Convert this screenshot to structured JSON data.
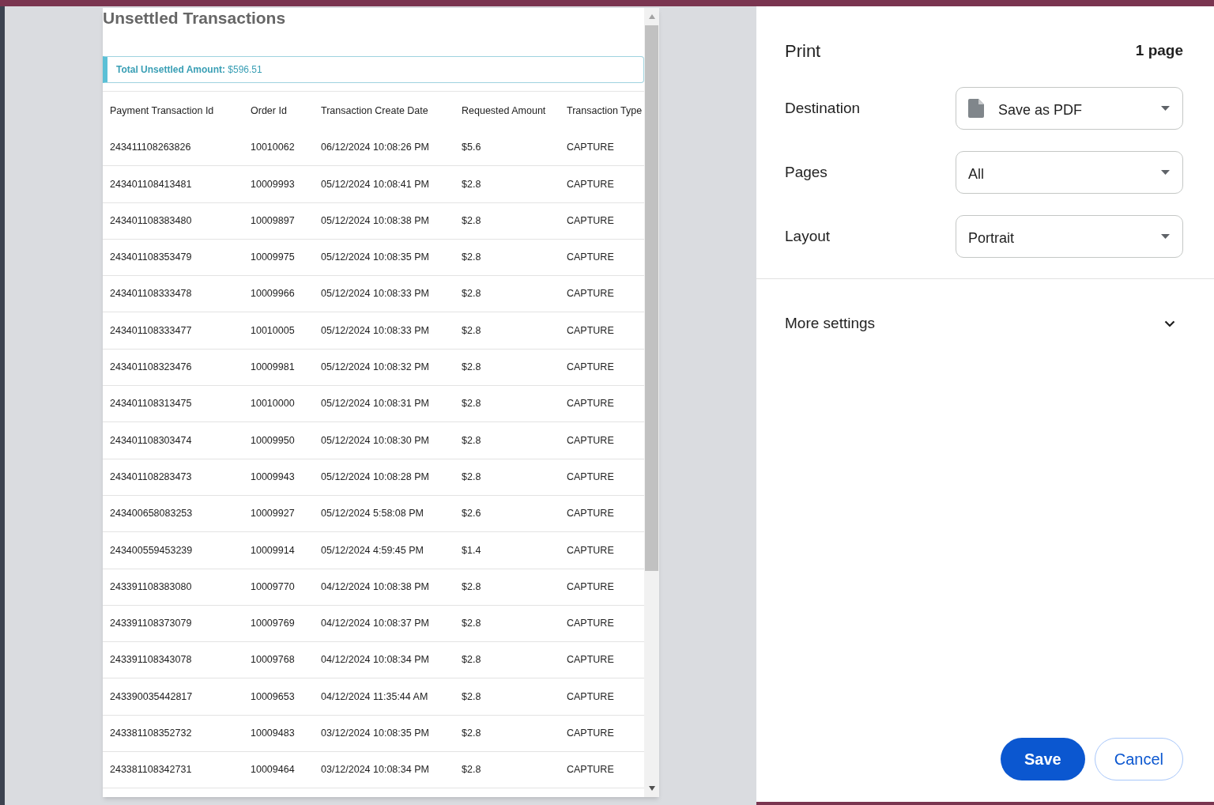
{
  "preview": {
    "title": "Unsettled Transactions",
    "total": {
      "label": "Total Unsettled Amount:",
      "value": "$596.51"
    },
    "columns": [
      "Payment Transaction Id",
      "Order Id",
      "Transaction Create Date",
      "Requested Amount",
      "Transaction Type"
    ],
    "rows": [
      [
        "243411108263826",
        "10010062",
        "06/12/2024 10:08:26 PM",
        "$5.6",
        "CAPTURE"
      ],
      [
        "243401108413481",
        "10009993",
        "05/12/2024 10:08:41 PM",
        "$2.8",
        "CAPTURE"
      ],
      [
        "243401108383480",
        "10009897",
        "05/12/2024 10:08:38 PM",
        "$2.8",
        "CAPTURE"
      ],
      [
        "243401108353479",
        "10009975",
        "05/12/2024 10:08:35 PM",
        "$2.8",
        "CAPTURE"
      ],
      [
        "243401108333478",
        "10009966",
        "05/12/2024 10:08:33 PM",
        "$2.8",
        "CAPTURE"
      ],
      [
        "243401108333477",
        "10010005",
        "05/12/2024 10:08:33 PM",
        "$2.8",
        "CAPTURE"
      ],
      [
        "243401108323476",
        "10009981",
        "05/12/2024 10:08:32 PM",
        "$2.8",
        "CAPTURE"
      ],
      [
        "243401108313475",
        "10010000",
        "05/12/2024 10:08:31 PM",
        "$2.8",
        "CAPTURE"
      ],
      [
        "243401108303474",
        "10009950",
        "05/12/2024 10:08:30 PM",
        "$2.8",
        "CAPTURE"
      ],
      [
        "243401108283473",
        "10009943",
        "05/12/2024 10:08:28 PM",
        "$2.8",
        "CAPTURE"
      ],
      [
        "243400658083253",
        "10009927",
        "05/12/2024 5:58:08 PM",
        "$2.6",
        "CAPTURE"
      ],
      [
        "243400559453239",
        "10009914",
        "05/12/2024 4:59:45 PM",
        "$1.4",
        "CAPTURE"
      ],
      [
        "243391108383080",
        "10009770",
        "04/12/2024 10:08:38 PM",
        "$2.8",
        "CAPTURE"
      ],
      [
        "243391108373079",
        "10009769",
        "04/12/2024 10:08:37 PM",
        "$2.8",
        "CAPTURE"
      ],
      [
        "243391108343078",
        "10009768",
        "04/12/2024 10:08:34 PM",
        "$2.8",
        "CAPTURE"
      ],
      [
        "243390035442817",
        "10009653",
        "04/12/2024 11:35:44 AM",
        "$2.8",
        "CAPTURE"
      ],
      [
        "243381108352732",
        "10009483",
        "03/12/2024 10:08:35 PM",
        "$2.8",
        "CAPTURE"
      ],
      [
        "243381108342731",
        "10009464",
        "03/12/2024 10:08:34 PM",
        "$2.8",
        "CAPTURE"
      ]
    ]
  },
  "print_panel": {
    "title": "Print",
    "page_count": "1 page",
    "settings": [
      {
        "label": "Destination",
        "value": "Save as PDF",
        "icon": true
      },
      {
        "label": "Pages",
        "value": "All",
        "icon": false
      },
      {
        "label": "Layout",
        "value": "Portrait",
        "icon": false
      }
    ],
    "more_settings": "More settings",
    "buttons": [
      {
        "label": "Save",
        "primary": true
      },
      {
        "label": "Cancel",
        "primary": false
      }
    ]
  }
}
